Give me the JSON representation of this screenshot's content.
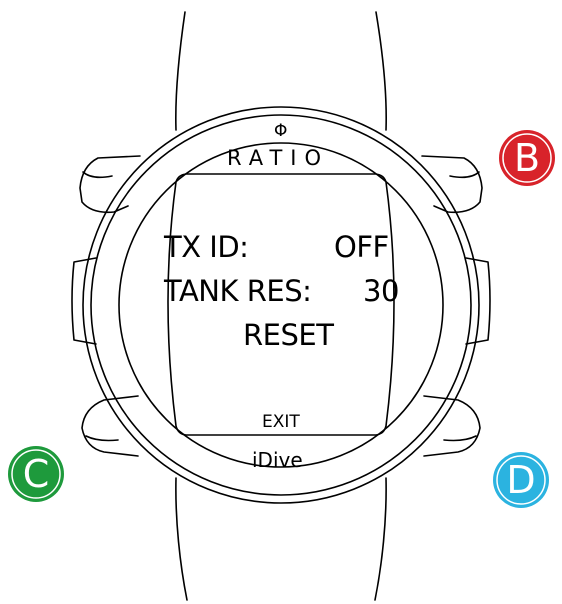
{
  "brand": {
    "logo_symbol": "Φ",
    "name": "RATIO",
    "model": "iDive"
  },
  "screen": {
    "rows": [
      {
        "label": "TX ID:",
        "value": "OFF"
      },
      {
        "label": "TANK RES:",
        "value": "30"
      }
    ],
    "reset_label": "RESET",
    "exit_label": "EXIT"
  },
  "buttons": {
    "b": {
      "label": "B",
      "color": "#d8232a"
    },
    "c": {
      "label": "C",
      "color": "#1e9a3c"
    },
    "d": {
      "label": "D",
      "color": "#2bb3e0"
    }
  }
}
